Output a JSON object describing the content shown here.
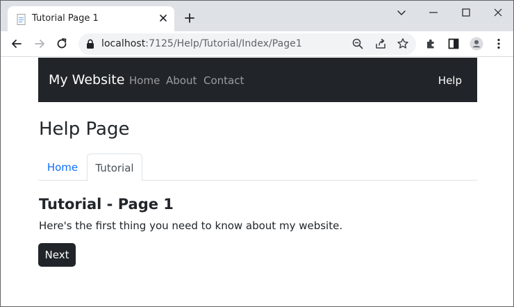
{
  "browser": {
    "tab": {
      "title": "Tutorial Page 1"
    },
    "address": {
      "host": "localhost",
      "path": ":7125/Help/Tutorial/Index/Page1"
    }
  },
  "navbar": {
    "brand": "My Website",
    "links": [
      "Home",
      "About",
      "Contact"
    ],
    "right_link": "Help"
  },
  "main": {
    "title": "Help Page",
    "tabs": [
      {
        "label": "Home",
        "active": false
      },
      {
        "label": "Tutorial",
        "active": true
      }
    ],
    "section_title": "Tutorial - Page 1",
    "section_text": "Here's the first thing you need to know about my website.",
    "next_button": "Next"
  },
  "colors": {
    "navbar_bg": "#212529",
    "link_blue": "#0d6efd",
    "button_bg": "#212529",
    "titlebar_bg": "#dee1e6"
  }
}
